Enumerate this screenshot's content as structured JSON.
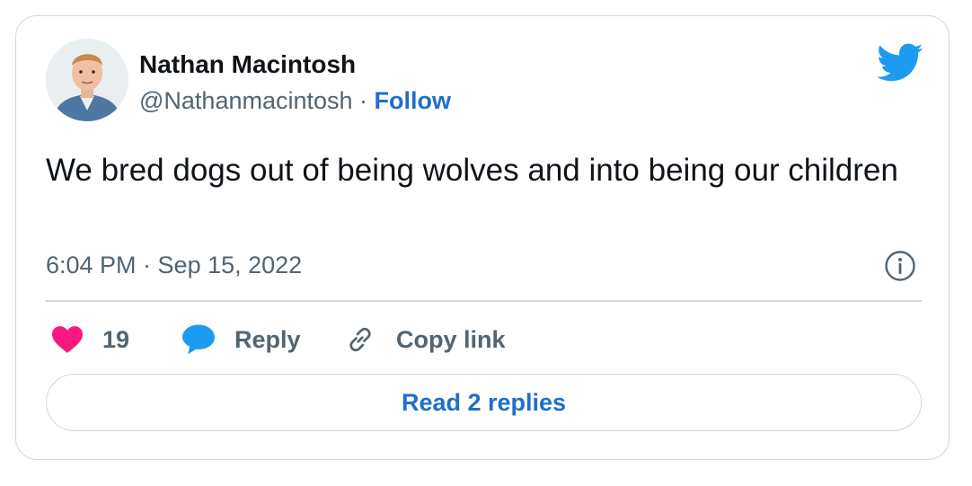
{
  "author": {
    "name": "Nathan Macintosh",
    "handle": "@Nathanmacintosh",
    "separator": " · ",
    "follow_label": "Follow"
  },
  "tweet": {
    "text": "We bred dogs out of being wolves and into being our children",
    "timestamp": "6:04 PM · Sep 15, 2022"
  },
  "actions": {
    "like_count": "19",
    "reply_label": "Reply",
    "copy_link_label": "Copy link"
  },
  "read_replies_label": "Read 2 replies",
  "icons": {
    "brand": "twitter-bird-icon",
    "info": "info-icon",
    "like": "heart-icon",
    "reply": "speech-bubble-icon",
    "copy": "link-icon"
  },
  "colors": {
    "twitter_blue": "#1d9bf0",
    "link_blue": "#1d6fc9",
    "like_pink": "#f91880",
    "muted_text": "#536471",
    "main_text": "#0f1419",
    "border": "#cfd9de"
  }
}
